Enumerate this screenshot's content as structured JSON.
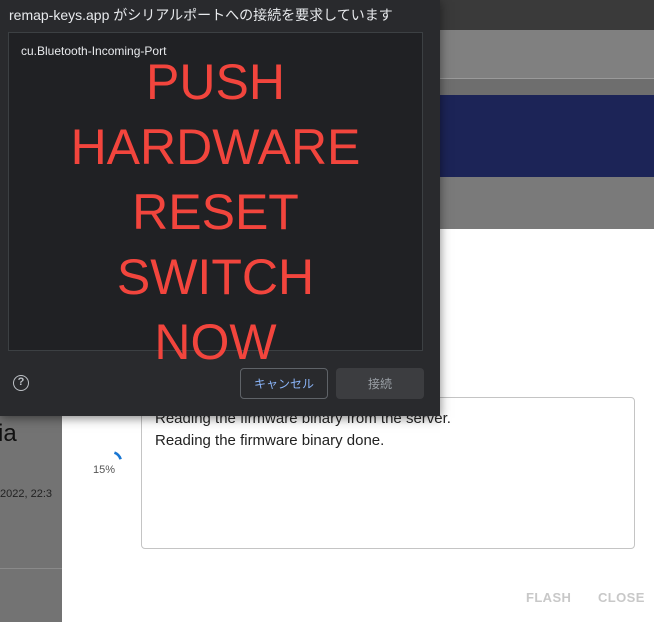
{
  "serial_dialog": {
    "title": "remap-keys.app がシリアルポートへの接続を要求しています",
    "ports": [
      "cu.Bluetooth-Incoming-Port"
    ],
    "overlay_lines": [
      "PUSH",
      "HARDWARE",
      "RESET",
      "SWITCH",
      "NOW"
    ],
    "help_symbol": "?",
    "cancel_label": "キャンセル",
    "connect_label": "接続"
  },
  "flash_dialog": {
    "log_lines": [
      "Reading the firmware binary from the server.",
      "Reading the firmware binary done."
    ],
    "progress_label": "15%",
    "progress": 0.15,
    "flash_label": "FLASH",
    "close_label": "CLOSE"
  },
  "background": {
    "title_fragment": "ia",
    "date_fragment": "2022, 22:3"
  },
  "colors": {
    "overlay_text": "#f2453d",
    "accent_blue": "#8ab4f8",
    "header_navy": "#1c2457",
    "spinner": "#1976d2"
  },
  "icons": {
    "help": "help-circle-icon",
    "spinner": "progress-spinner-icon"
  }
}
